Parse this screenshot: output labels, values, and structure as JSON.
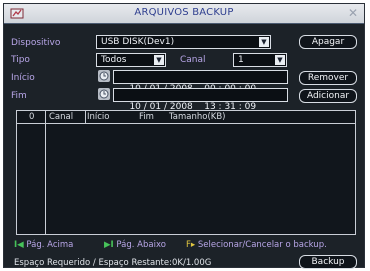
{
  "window": {
    "title": "ARQUIVOS BACKUP",
    "close": "✕"
  },
  "form": {
    "device": {
      "label": "Dispositivo",
      "value": "USB DISK(Dev1)"
    },
    "type": {
      "label": "Tipo",
      "value": "Todos"
    },
    "channel": {
      "label": "Canal",
      "value": "1"
    },
    "start": {
      "label": "Início",
      "date": "10 / 01 / 2008",
      "time": "00 : 00 : 00"
    },
    "end": {
      "label": "Fim",
      "date": "10 / 01 / 2008",
      "time": "13 : 31 : 09"
    }
  },
  "buttons": {
    "apagar": "Apagar",
    "remover": "Remover",
    "adicionar": "Adicionar",
    "backup": "Backup"
  },
  "table": {
    "columns": [
      "0",
      "Canal",
      "Início",
      "Fim",
      "Tamanho(KB)"
    ],
    "rows": []
  },
  "legend": {
    "prev_key": "I◀",
    "prev": "Pág. Acima",
    "next_key": "▶I",
    "next": "Pág. Abaixo",
    "fn_key": "F▸",
    "fn": "Selecionar/Cancelar o backup."
  },
  "status": {
    "space": "Espaço Requerido / Espaço Restante:0K/1.00G"
  }
}
